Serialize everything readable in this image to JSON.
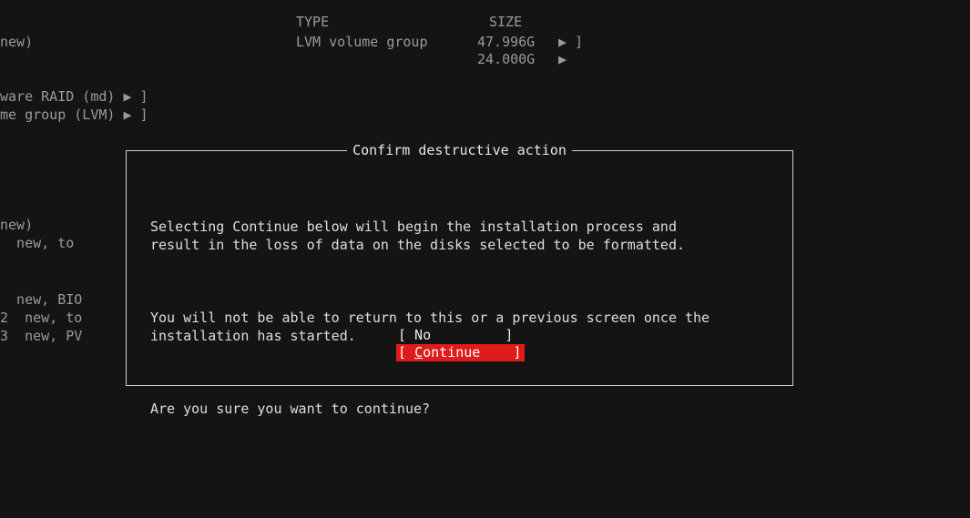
{
  "background": {
    "header_type": "TYPE",
    "header_size": "SIZE",
    "rows": [
      {
        "left": "new)",
        "type": "LVM volume group",
        "size": "47.996G",
        "arrow": "▶ ]"
      },
      {
        "left": "",
        "type": "",
        "size": "24.000G",
        "arrow": "▶"
      }
    ],
    "actions": [
      "ware RAID (md) ▶ ]",
      "me group (LVM) ▶ ]"
    ],
    "device_lines": [
      "new)",
      "  new, to",
      "",
      "  new, BIO",
      "2  new, to",
      "3  new, PV"
    ]
  },
  "dialog": {
    "title": "Confirm destructive action",
    "paragraph1": "Selecting Continue below will begin the installation process and\nresult in the loss of data on the disks selected to be formatted.",
    "paragraph2": "You will not be able to return to this or a previous screen once the\ninstallation has started.",
    "question": "Are you sure you want to continue?",
    "buttons": {
      "no_label": "[ No         ]",
      "continue_open": "[ ",
      "continue_mnemonic": "C",
      "continue_rest": "ontinue    ]"
    }
  },
  "colors": {
    "background": "#141414",
    "selected_button": "#e01b1b",
    "border": "#cfcfcf"
  }
}
